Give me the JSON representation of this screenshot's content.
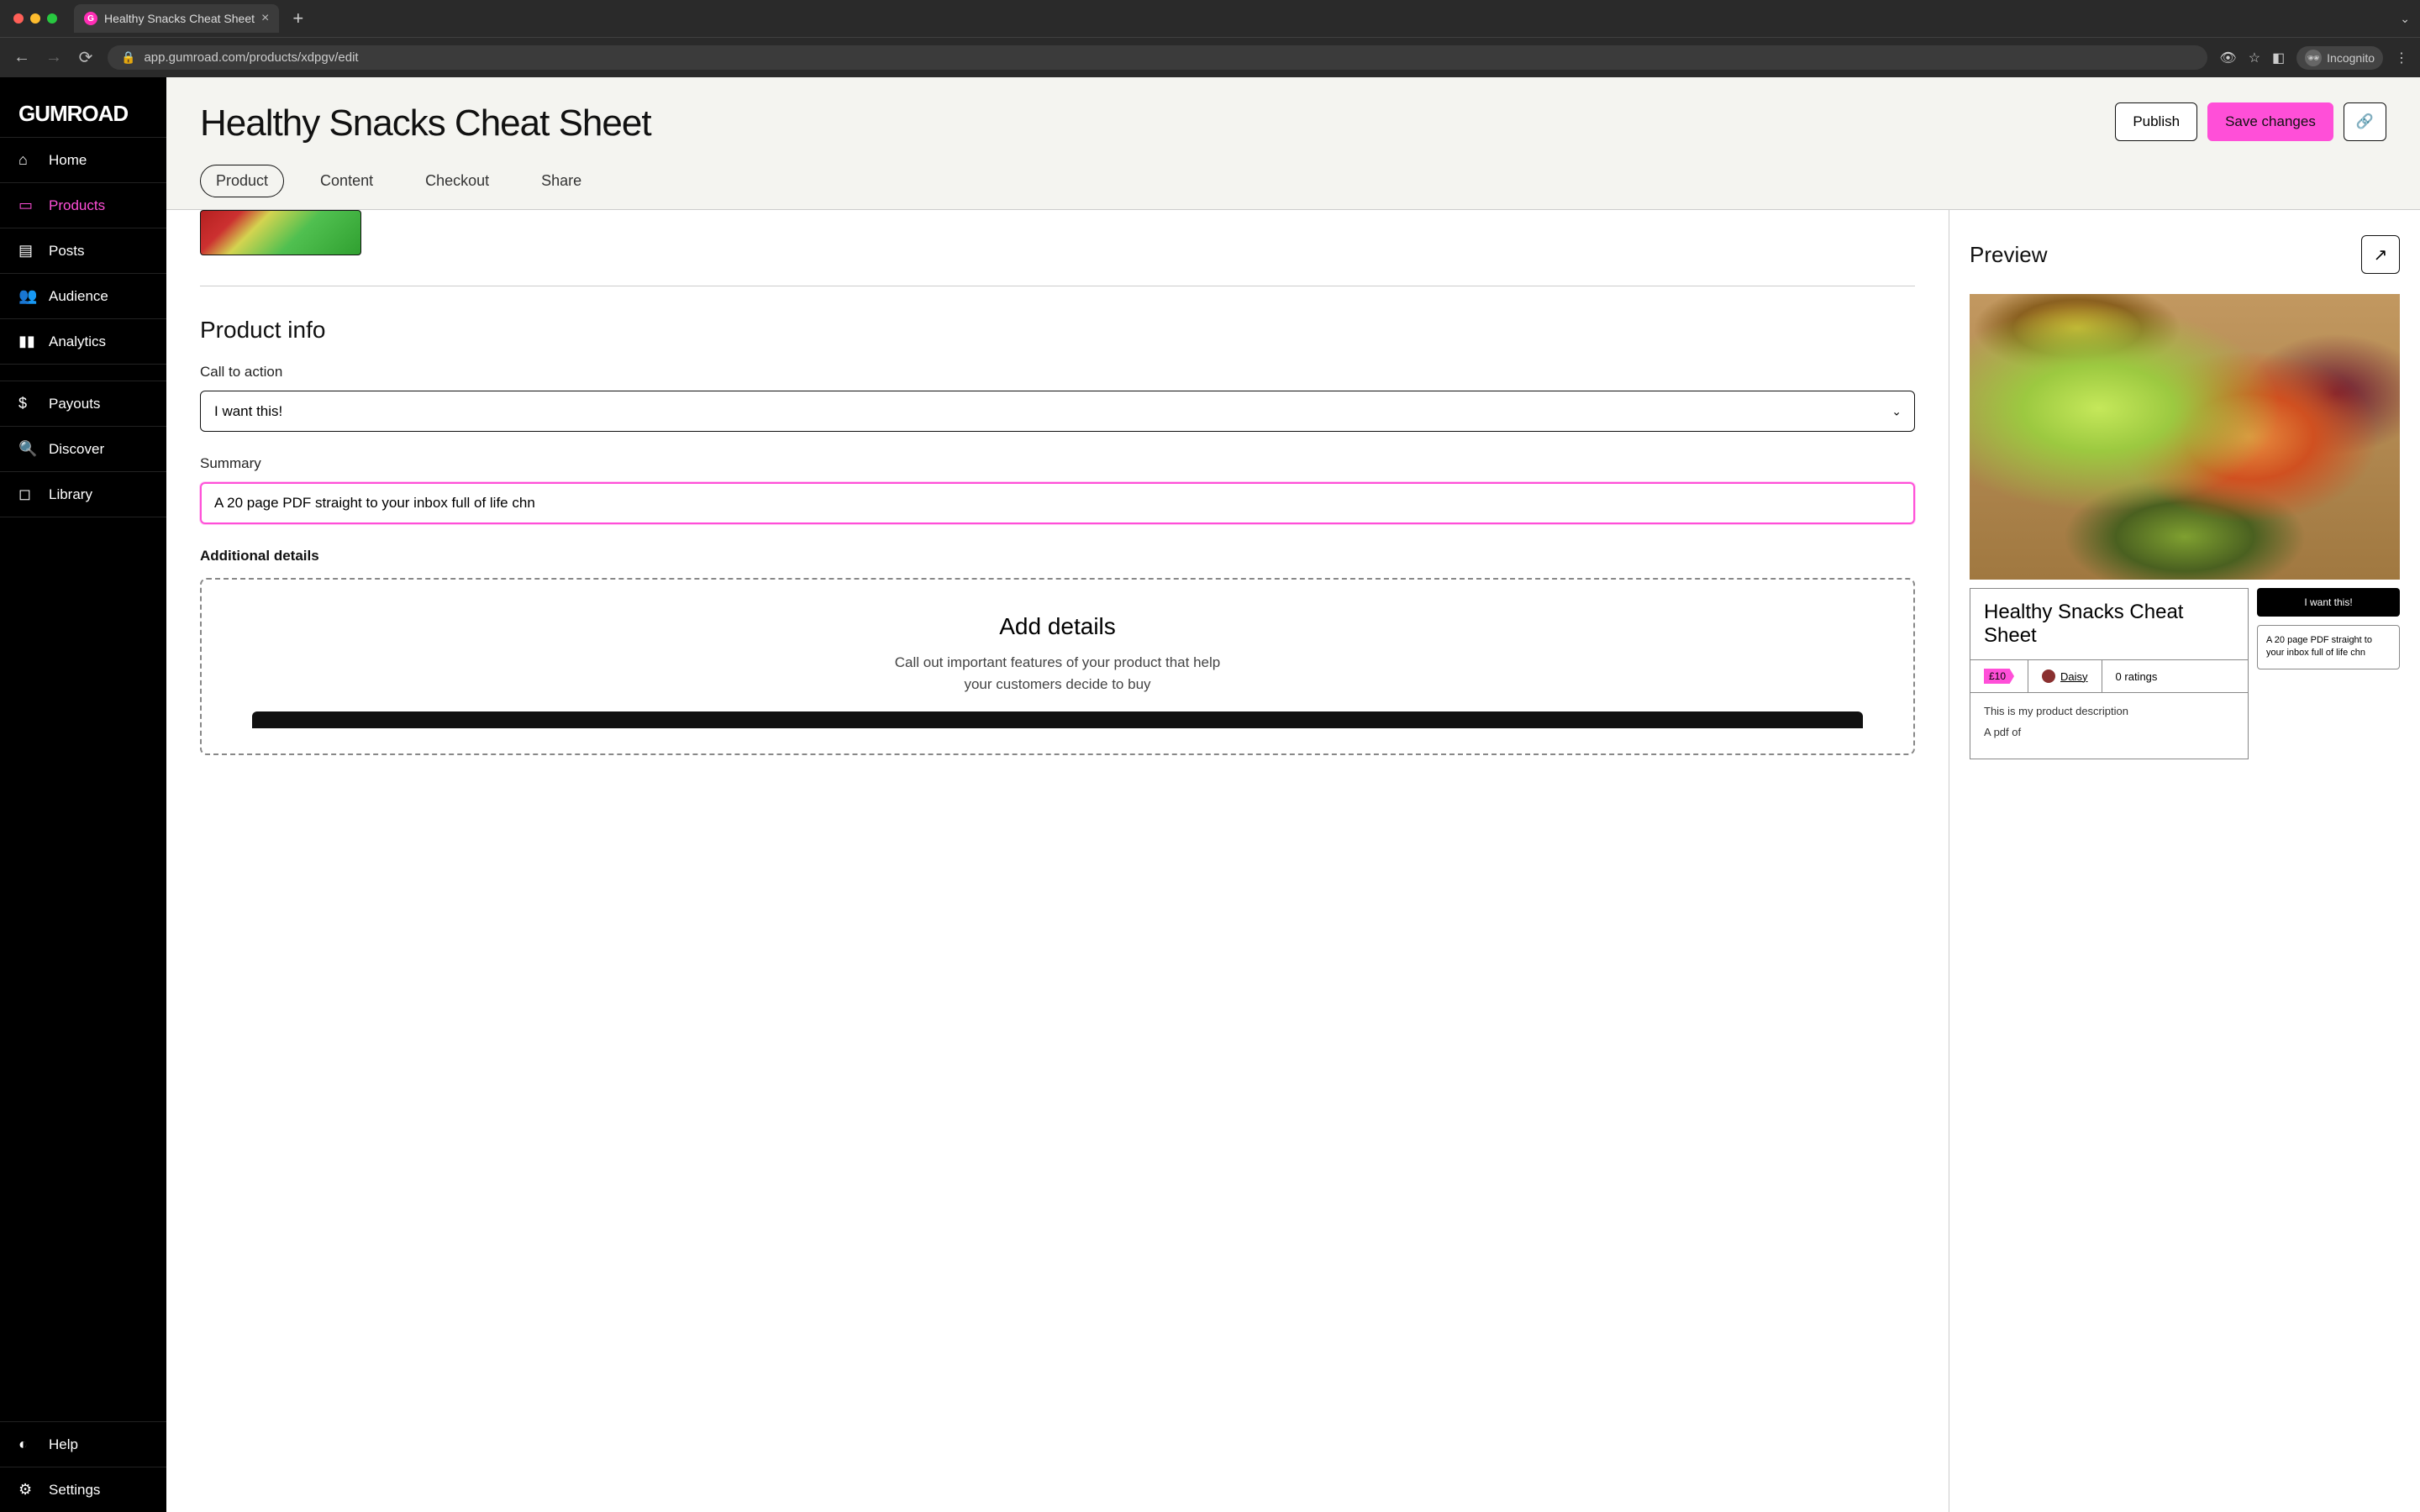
{
  "browser": {
    "tab_title": "Healthy Snacks Cheat Sheet",
    "url": "app.gumroad.com/products/xdpgv/edit",
    "incognito_label": "Incognito"
  },
  "sidebar": {
    "logo": "GUMROAD",
    "items": [
      {
        "label": "Home"
      },
      {
        "label": "Products"
      },
      {
        "label": "Posts"
      },
      {
        "label": "Audience"
      },
      {
        "label": "Analytics"
      }
    ],
    "items2": [
      {
        "label": "Payouts"
      },
      {
        "label": "Discover"
      },
      {
        "label": "Library"
      }
    ],
    "bottom": [
      {
        "label": "Help"
      },
      {
        "label": "Settings"
      }
    ]
  },
  "header": {
    "title": "Healthy Snacks Cheat Sheet",
    "publish": "Publish",
    "save": "Save changes"
  },
  "tabs": [
    {
      "label": "Product"
    },
    {
      "label": "Content"
    },
    {
      "label": "Checkout"
    },
    {
      "label": "Share"
    }
  ],
  "form": {
    "section_title": "Product info",
    "cta_label": "Call to action",
    "cta_value": "I want this!",
    "summary_label": "Summary",
    "summary_value": "A 20 page PDF straight to your inbox full of life chn",
    "details_label": "Additional details",
    "details_box_title": "Add details",
    "details_box_desc": "Call out important features of your product that help your customers decide to buy"
  },
  "preview": {
    "heading": "Preview",
    "product_title": "Healthy Snacks Cheat Sheet",
    "price": "£10",
    "author": "Daisy",
    "ratings": "0 ratings",
    "description_line1": "This is my product description",
    "description_line2": "A pdf of",
    "buy_label": "I want this!",
    "summary_text": "A 20 page PDF straight to your inbox full of life chn"
  }
}
